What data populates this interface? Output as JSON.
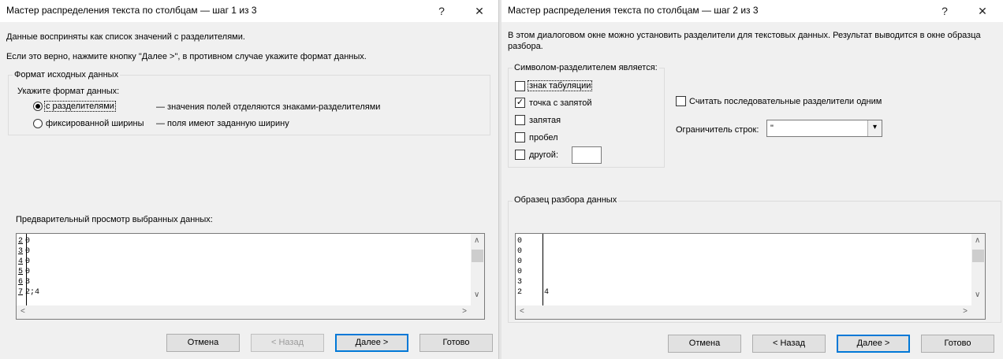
{
  "step1": {
    "title": "Мастер распределения текста по столбцам — шаг 1 из 3",
    "help_glyph": "?",
    "close_glyph": "✕",
    "info_line1": "Данные восприняты как список значений с разделителями.",
    "info_line2": "Если это верно, нажмите кнопку \"Далее >\", в противном случае укажите формат данных.",
    "group_title": "Формат исходных данных",
    "format_prompt": "Укажите формат данных:",
    "options": [
      {
        "label": "с разделителями",
        "description": "— значения полей отделяются знаками-разделителями",
        "selected": true
      },
      {
        "label": "фиксированной ширины",
        "description": "— поля имеют заданную ширину",
        "selected": false
      }
    ],
    "preview_label": "Предварительный просмотр выбранных данных:",
    "preview_rows": [
      {
        "num": "2",
        "text": "0"
      },
      {
        "num": "3",
        "text": "0"
      },
      {
        "num": "4",
        "text": "0"
      },
      {
        "num": "5",
        "text": "0"
      },
      {
        "num": "6",
        "text": "3"
      },
      {
        "num": "7",
        "text": "2;4"
      }
    ],
    "buttons": {
      "cancel": "Отмена",
      "back": "< Назад",
      "next": "Далее >",
      "finish": "Готово"
    }
  },
  "step2": {
    "title": "Мастер распределения текста по столбцам — шаг 2 из 3",
    "help_glyph": "?",
    "close_glyph": "✕",
    "info_line1": "В этом диалоговом окне можно установить разделители для текстовых данных. Результат выводится в окне образца",
    "info_line2": "разбора.",
    "delimiters_title": "Символом-разделителем является:",
    "delimiters": [
      {
        "label": "знак табуляции",
        "checked": false
      },
      {
        "label": "точка с запятой",
        "checked": true
      },
      {
        "label": "запятая",
        "checked": false
      },
      {
        "label": "пробел",
        "checked": false
      },
      {
        "label": "другой:",
        "checked": false
      }
    ],
    "check_mark": "✓",
    "consecutive_label": "Считать последовательные разделители одним",
    "consecutive_checked": false,
    "qualifier_label": "Ограничитель строк:",
    "qualifier_value": "\"",
    "dropdown_glyph": "▾",
    "preview_title": "Образец разбора данных",
    "preview_col1": [
      "0",
      "0",
      "0",
      "0",
      "3",
      "2"
    ],
    "preview_col2": [
      "",
      "",
      "",
      "",
      "",
      "4"
    ],
    "buttons": {
      "cancel": "Отмена",
      "back": "< Назад",
      "next": "Далее >",
      "finish": "Готово"
    }
  },
  "scroll_glyphs": {
    "up": "∧",
    "down": "∨",
    "left": "<",
    "right": ">"
  }
}
